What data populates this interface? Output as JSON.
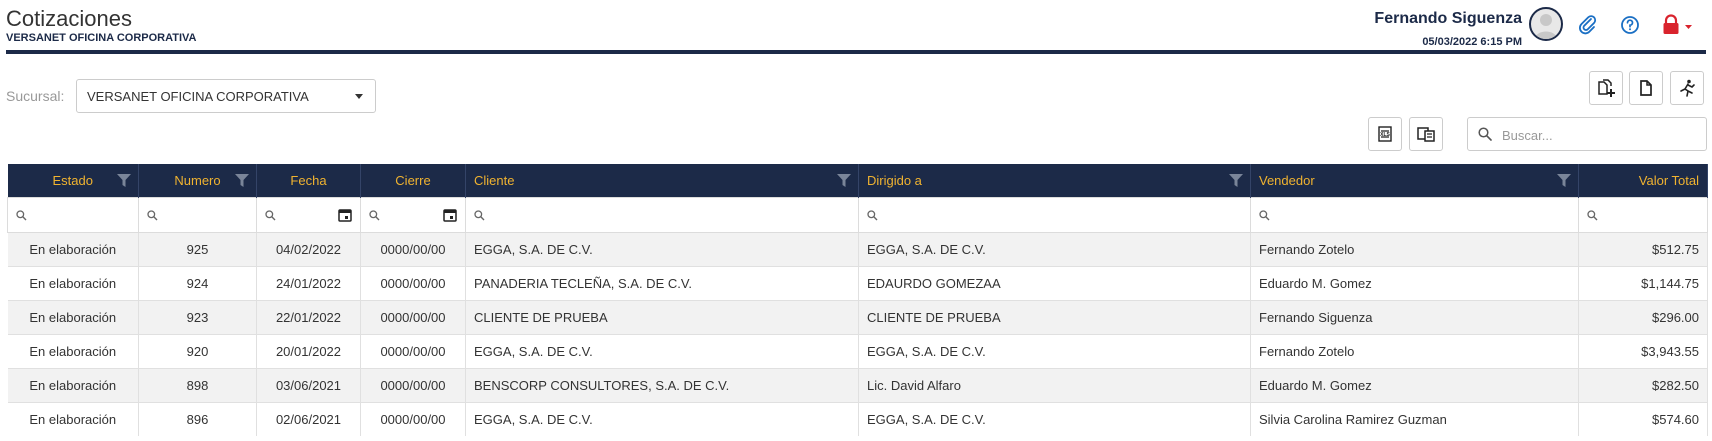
{
  "header": {
    "title": "Cotizaciones",
    "subtitle": "VERSANET OFICINA CORPORATIVA",
    "user_name": "Fernando Siguenza",
    "datetime": "05/03/2022 6:15 PM"
  },
  "toolbar": {
    "sucursal_label": "Sucursal:",
    "sucursal_value": "VERSANET OFICINA CORPORATIVA",
    "search_placeholder": "Buscar..."
  },
  "colors": {
    "navy": "#1c2a48",
    "header_text": "#f0b330",
    "lock_red": "#d9232d",
    "link_blue": "#1a6fc4"
  },
  "table": {
    "columns": [
      "Estado",
      "Numero",
      "Fecha",
      "Cierre",
      "Cliente",
      "Dirigido a",
      "Vendedor",
      "Valor Total"
    ],
    "rows": [
      [
        "En elaboración",
        "925",
        "04/02/2022",
        "0000/00/00",
        "EGGA, S.A. DE C.V.",
        "EGGA, S.A. DE C.V.",
        "Fernando Zotelo",
        "$512.75"
      ],
      [
        "En elaboración",
        "924",
        "24/01/2022",
        "0000/00/00",
        "PANADERIA TECLEÑA, S.A. DE C.V.",
        "EDAURDO GOMEZAA",
        "Eduardo M. Gomez",
        "$1,144.75"
      ],
      [
        "En elaboración",
        "923",
        "22/01/2022",
        "0000/00/00",
        "CLIENTE DE PRUEBA",
        "CLIENTE DE PRUEBA",
        "Fernando Siguenza",
        "$296.00"
      ],
      [
        "En elaboración",
        "920",
        "20/01/2022",
        "0000/00/00",
        "EGGA, S.A. DE C.V.",
        "EGGA, S.A. DE C.V.",
        "Fernando Zotelo",
        "$3,943.55"
      ],
      [
        "En elaboración",
        "898",
        "03/06/2021",
        "0000/00/00",
        "BENSCORP CONSULTORES, S.A. DE C.V.",
        "Lic. David Alfaro",
        "Eduardo M. Gomez",
        "$282.50"
      ],
      [
        "En elaboración",
        "896",
        "02/06/2021",
        "0000/00/00",
        "EGGA, S.A. DE C.V.",
        "EGGA, S.A. DE C.V.",
        "Silvia Carolina Ramirez Guzman",
        "$574.60"
      ]
    ]
  }
}
